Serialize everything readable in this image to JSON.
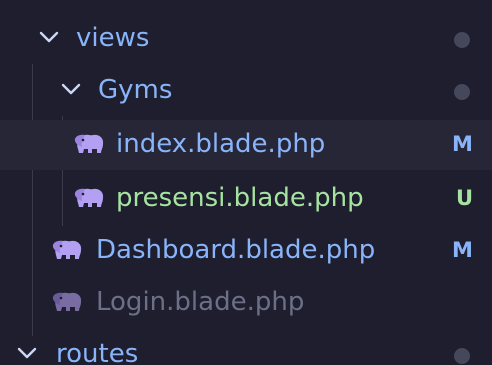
{
  "tree": {
    "views": {
      "label": "views",
      "icon": "chevron-down-icon"
    },
    "gyms": {
      "label": "Gyms",
      "icon": "chevron-down-icon"
    },
    "index": {
      "label": "index.blade.php",
      "status": "M",
      "icon": "php-elephant-icon"
    },
    "presensi": {
      "label": "presensi.blade.php",
      "status": "U",
      "icon": "php-elephant-icon"
    },
    "dashboard": {
      "label": "Dashboard.blade.php",
      "status": "M",
      "icon": "php-elephant-icon"
    },
    "login": {
      "label": "Login.blade.php",
      "icon": "php-elephant-icon"
    },
    "routes": {
      "label": "routes",
      "icon": "chevron-down-icon"
    }
  },
  "colors": {
    "background": "#1e1e2e",
    "folder_text": "#89b4fa",
    "modified": "#89b4fa",
    "untracked": "#a6e3a1",
    "ignored": "#6c7086",
    "elephant": "#b4a0f2",
    "dot": "#45475a"
  }
}
